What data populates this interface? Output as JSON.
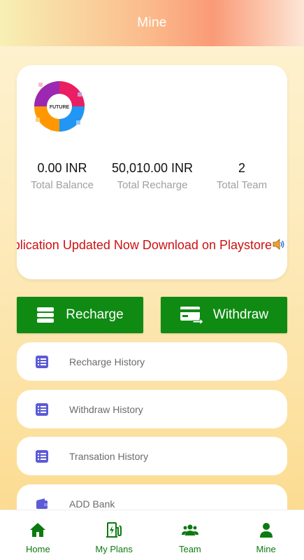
{
  "header": {
    "title": "Mine"
  },
  "card": {
    "logo_text": "FUTURE",
    "stats": [
      {
        "value": "0.00 INR",
        "label": "Total Balance"
      },
      {
        "value": "50,010.00 INR",
        "label": "Total Recharge"
      },
      {
        "value": "2",
        "label": "Total Team"
      }
    ],
    "marquee": "plication Updated Now Download on Playstore"
  },
  "actions": {
    "recharge": "Recharge",
    "withdraw": "Withdraw"
  },
  "menu": [
    {
      "label": "Recharge History",
      "icon": "list-icon"
    },
    {
      "label": "Withdraw History",
      "icon": "list-icon"
    },
    {
      "label": "Transation History",
      "icon": "list-icon"
    },
    {
      "label": "ADD Bank",
      "icon": "wallet-icon"
    }
  ],
  "nav": [
    {
      "label": "Home",
      "icon": "home-icon"
    },
    {
      "label": "My Plans",
      "icon": "charging-station-icon"
    },
    {
      "label": "Team",
      "icon": "users-icon"
    },
    {
      "label": "Mine",
      "icon": "user-icon"
    }
  ],
  "colors": {
    "primary_green": "#0f8a13",
    "menu_icon": "#5b5bd6",
    "marquee_red": "#cc1111"
  }
}
